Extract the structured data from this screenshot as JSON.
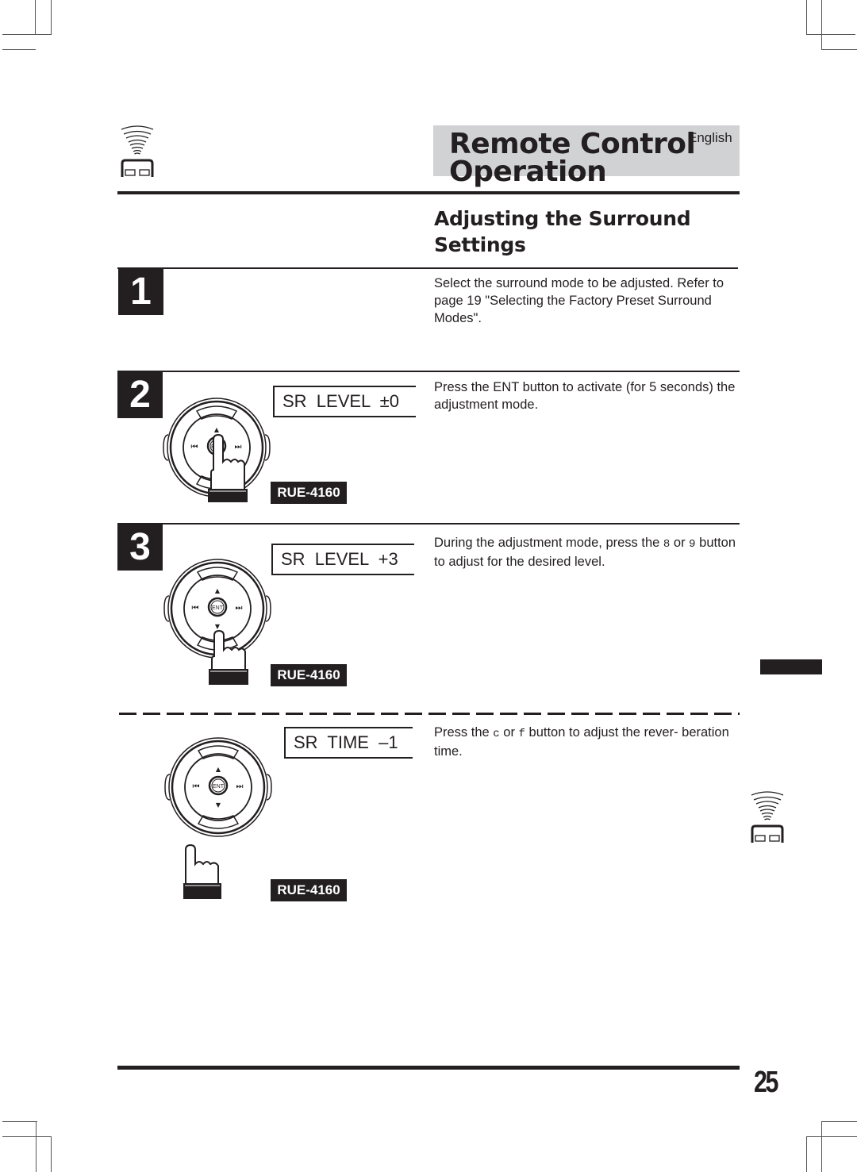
{
  "header": {
    "title_line1": "Remote Control",
    "title_line2": "Operation",
    "language": "English",
    "icon": "remote-signal-icon"
  },
  "section": {
    "title_line1": "Adjusting the Surround",
    "title_line2": "Settings"
  },
  "steps": [
    {
      "number": "1",
      "description": "Select the surround mode to be adjusted. Refer to page 19 \"Selecting the Factory Preset Surround Modes\"."
    },
    {
      "number": "2",
      "display": "SR  LEVEL  ±0",
      "model": "RUE-4160",
      "description": "Press the ENT button to activate (for 5 seconds) the adjustment mode.",
      "pressed_button": "ENT"
    },
    {
      "number": "3",
      "display": "SR  LEVEL  +3",
      "model": "RUE-4160",
      "description_pre": "During the adjustment mode, press the ",
      "key1": "8",
      "description_mid": " or ",
      "key2": "9",
      "description_post": " button to adjust for the desired level.",
      "pressed_button": "down"
    },
    {
      "number": "",
      "display": "SR  TIME  –1",
      "model": "RUE-4160",
      "description_pre": "Press the ",
      "key1": "c",
      "description_mid": "  or ",
      "key2": "f",
      "description_post": "   button to adjust the rever- beration time."
    }
  ],
  "remote": {
    "ent_label": "ENT",
    "prev_label": "⏮",
    "next_label": "⏭",
    "up_label": "▲",
    "down_label": "▼"
  },
  "footer": {
    "page_number": "25"
  }
}
